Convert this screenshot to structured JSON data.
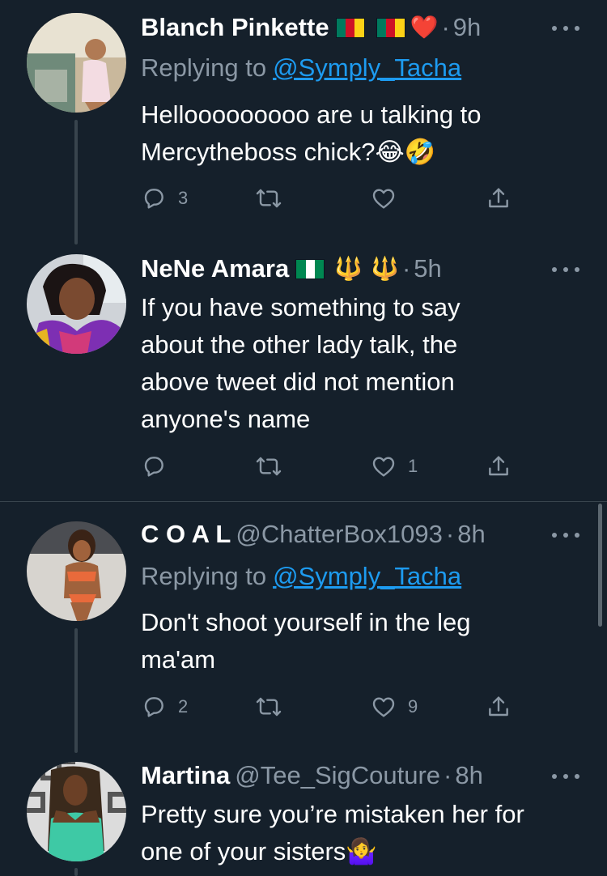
{
  "tweets": [
    {
      "name": "Blanch Pinkette",
      "handle": "",
      "time": "9h",
      "replying_label": "Replying to",
      "replying_to": "@Symply_Tacha",
      "text_line1": "Hellooooooooo are u talking to",
      "text_line2": "Mercytheboss chick?😂🤣",
      "reply_count": "3",
      "retweet_count": "",
      "like_count": ""
    },
    {
      "name": "NeNe Amara",
      "handle": "",
      "time": "5h",
      "text": "If you have something to say about the other lady talk, the above tweet did not mention anyone's name",
      "reply_count": "",
      "retweet_count": "",
      "like_count": "1"
    },
    {
      "name": "C O A L",
      "handle": "@ChatterBox1093",
      "time": "8h",
      "replying_label": "Replying to",
      "replying_to": "@Symply_Tacha",
      "text": "Don't shoot yourself in the leg ma'am",
      "reply_count": "2",
      "retweet_count": "",
      "like_count": "9"
    },
    {
      "name": "Martina",
      "handle": "@Tee_SigCouture",
      "time": "8h",
      "text": "Pretty sure you’re mistaken her for one of your sisters🤷‍♀️"
    }
  ],
  "flags": {
    "cameroon": [
      "#007a5e",
      "#ce1126",
      "#fcd116"
    ],
    "nigeria": [
      "#008751",
      "#ffffff",
      "#008751"
    ]
  },
  "icons": {
    "reply": "reply-icon",
    "retweet": "retweet-icon",
    "like": "heart-icon",
    "share": "share-icon",
    "more": "more-icon",
    "heart_emoji": "❤️",
    "trident_emoji": "🔱"
  },
  "colors": {
    "background": "#15202b",
    "secondary_text": "#8b98a5",
    "link": "#1d9bf0",
    "thread_line": "#38444d"
  }
}
